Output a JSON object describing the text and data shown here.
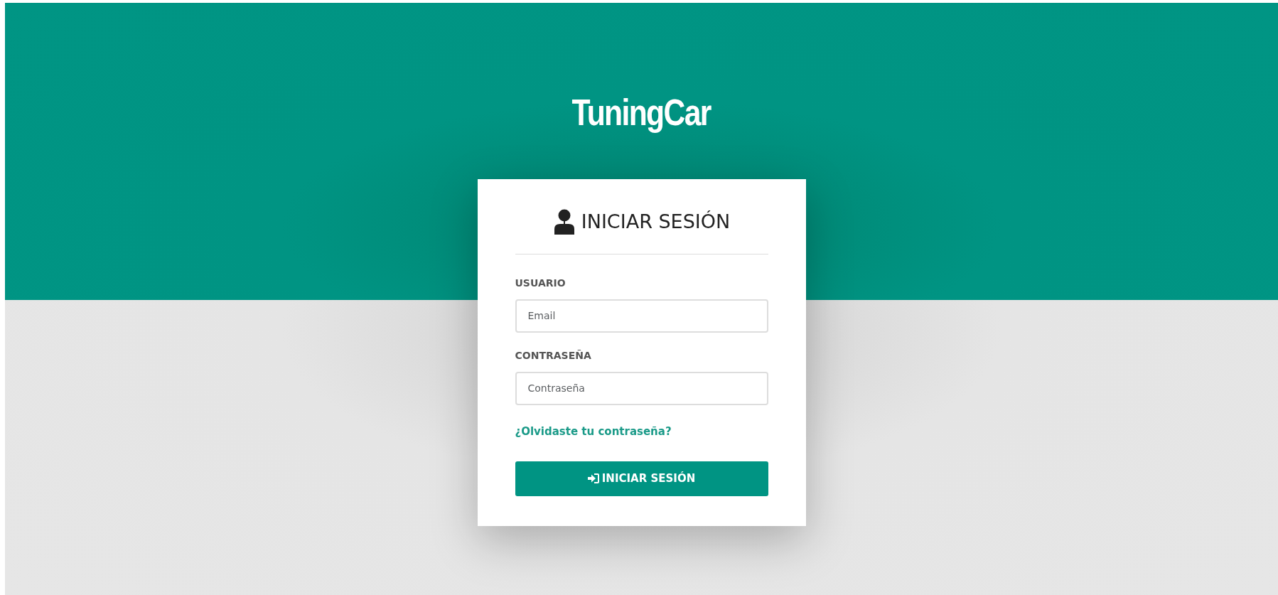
{
  "brand": "TuningCar",
  "login": {
    "title": "INICIAR SESIÓN",
    "fields": [
      {
        "label": "USUARIO",
        "placeholder": "Email"
      },
      {
        "label": "CONTRASEÑA",
        "placeholder": "Contraseña"
      }
    ],
    "forgot_link": "¿Olvidaste tu contraseña?",
    "submit": "INICIAR SESIÓN"
  }
}
